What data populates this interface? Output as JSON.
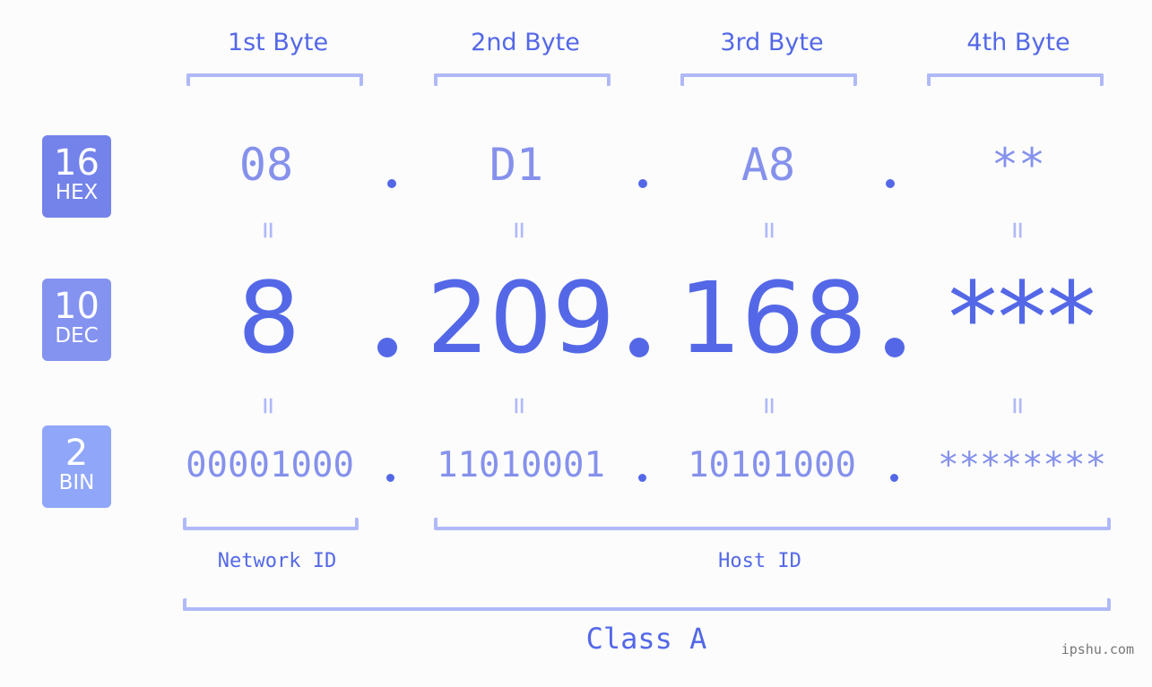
{
  "bytes": [
    {
      "label": "1st Byte",
      "hex": "08",
      "dec": "8",
      "bin": "00001000"
    },
    {
      "label": "2nd Byte",
      "hex": "D1",
      "dec": "209",
      "bin": "11010001"
    },
    {
      "label": "3rd Byte",
      "hex": "A8",
      "dec": "168",
      "bin": "10101000"
    },
    {
      "label": "4th Byte",
      "hex": "**",
      "dec": "***",
      "bin": "********"
    }
  ],
  "badges": {
    "hex": {
      "num": "16",
      "tag": "HEX",
      "color": "#7483ea"
    },
    "dec": {
      "num": "10",
      "tag": "DEC",
      "color": "#8493f0"
    },
    "bin": {
      "num": "2",
      "tag": "BIN",
      "color": "#8fa6f9"
    }
  },
  "equals_sign": "=",
  "network_label": "Network ID",
  "host_label": "Host ID",
  "class_label": "Class A",
  "watermark": "ipshu.com",
  "colors": {
    "accent": "#5468e7",
    "light": "#8591ec",
    "bracket": "#b0b9f8"
  }
}
